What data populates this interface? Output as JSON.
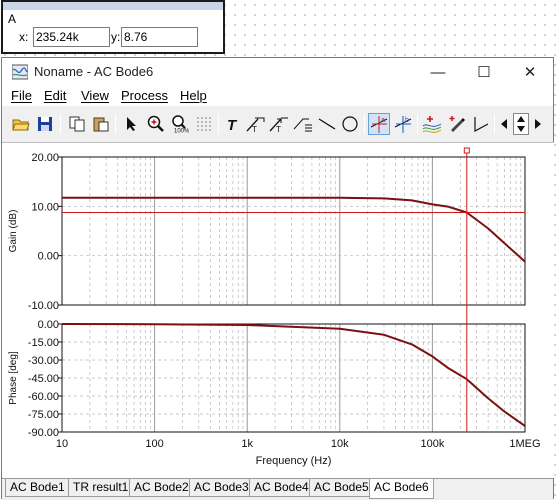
{
  "cursor_box": {
    "trace_label": "A",
    "x_label": "x:",
    "x_value": "235.24k",
    "y_label": "y:",
    "y_value": "8.76"
  },
  "window": {
    "title": "Noname - AC Bode6",
    "controls": {
      "minimize": "—",
      "maximize": "☐",
      "close": "✕"
    }
  },
  "menu": [
    "File",
    "Edit",
    "View",
    "Process",
    "Help"
  ],
  "toolbar": [
    "open-icon",
    "save-icon",
    "copy-icon",
    "paste-icon",
    "pointer-icon",
    "zoom-in-icon",
    "zoom-out-100-icon",
    "grid-icon",
    "text-icon",
    "line-label-icon",
    "arrow-label-icon",
    "comment-icon",
    "line-icon",
    "circle-icon",
    "cursor-a-icon",
    "cursor-b-icon",
    "add-curve-icon",
    "pen-icon",
    "angle-icon",
    "scroll-left-icon",
    "scroll-up-down-icon",
    "scroll-right-icon"
  ],
  "colors": {
    "curve": "#7a1010",
    "cursor": "#d01818",
    "grid": "#b8b8b8"
  },
  "tabs": [
    "AC Bode1",
    "TR result1",
    "AC Bode2",
    "AC Bode3",
    "AC Bode4",
    "AC Bode5",
    "AC Bode6"
  ],
  "active_tab": "AC Bode6",
  "chart_data": [
    {
      "type": "line",
      "ylabel": "Gain (dB)",
      "xscale": "log",
      "xlim": [
        10,
        1000000
      ],
      "ylim": [
        -10,
        20
      ],
      "yticks": [
        "20.00",
        "10.00",
        "0.00",
        "-10.00"
      ],
      "series": [
        {
          "x": [
            10,
            100,
            1000,
            10000,
            30000,
            60000,
            100000,
            150000,
            235240,
            400000,
            600000,
            1000000
          ],
          "values": [
            11.76,
            11.76,
            11.76,
            11.74,
            11.6,
            11.2,
            10.4,
            9.9,
            8.76,
            5.5,
            2.5,
            -1.2
          ]
        }
      ],
      "cursor": {
        "x": 235240,
        "y": 8.76
      }
    },
    {
      "type": "line",
      "xlabel": "Frequency (Hz)",
      "ylabel": "Phase [deg]",
      "xscale": "log",
      "xlim": [
        10,
        1000000
      ],
      "ylim": [
        -90,
        0
      ],
      "yticks": [
        "0.00",
        "-15.00",
        "-30.00",
        "-45.00",
        "-60.00",
        "-75.00",
        "-90.00"
      ],
      "xticks": [
        "10",
        "100",
        "1k",
        "10k",
        "100k",
        "1MEG"
      ],
      "series": [
        {
          "x": [
            10,
            100,
            1000,
            10000,
            30000,
            60000,
            100000,
            150000,
            235240,
            400000,
            600000,
            1000000
          ],
          "values": [
            0,
            -0.2,
            -0.8,
            -4,
            -9,
            -17,
            -27,
            -37,
            -46,
            -62,
            -73,
            -85
          ]
        }
      ],
      "cursor": {
        "x": 235240
      }
    }
  ]
}
